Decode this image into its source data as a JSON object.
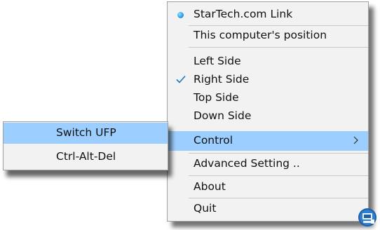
{
  "menu": {
    "items": [
      {
        "label": "StarTech.com Link"
      },
      {
        "label": "This computer's position"
      },
      {
        "label": "Left Side"
      },
      {
        "label": "Right Side"
      },
      {
        "label": "Top Side"
      },
      {
        "label": "Down Side"
      },
      {
        "label": "Control"
      },
      {
        "label": "Advanced Setting .."
      },
      {
        "label": "About"
      },
      {
        "label": "Quit"
      }
    ]
  },
  "submenu": {
    "items": [
      {
        "label": "Switch UFP"
      },
      {
        "label": "Ctrl-Alt-Del"
      }
    ]
  },
  "colors": {
    "highlight": "#9ccfff",
    "menu_background": "#f2f2f2",
    "check": "#1a73c8"
  },
  "icons": {
    "app": "startech-dot-icon",
    "checked": "checkmark-icon",
    "submenu": "chevron-right-icon",
    "tray": "startech-tray-icon"
  }
}
